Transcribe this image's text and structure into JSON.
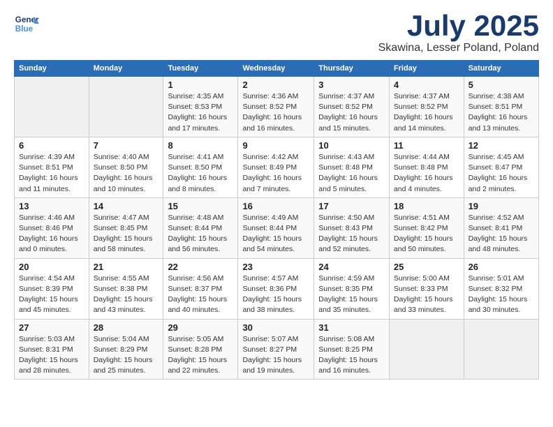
{
  "header": {
    "logo_general": "General",
    "logo_blue": "Blue",
    "month_title": "July 2025",
    "location": "Skawina, Lesser Poland, Poland"
  },
  "weekdays": [
    "Sunday",
    "Monday",
    "Tuesday",
    "Wednesday",
    "Thursday",
    "Friday",
    "Saturday"
  ],
  "weeks": [
    [
      {
        "day": "",
        "detail": ""
      },
      {
        "day": "",
        "detail": ""
      },
      {
        "day": "1",
        "detail": "Sunrise: 4:35 AM\nSunset: 8:53 PM\nDaylight: 16 hours\nand 17 minutes."
      },
      {
        "day": "2",
        "detail": "Sunrise: 4:36 AM\nSunset: 8:52 PM\nDaylight: 16 hours\nand 16 minutes."
      },
      {
        "day": "3",
        "detail": "Sunrise: 4:37 AM\nSunset: 8:52 PM\nDaylight: 16 hours\nand 15 minutes."
      },
      {
        "day": "4",
        "detail": "Sunrise: 4:37 AM\nSunset: 8:52 PM\nDaylight: 16 hours\nand 14 minutes."
      },
      {
        "day": "5",
        "detail": "Sunrise: 4:38 AM\nSunset: 8:51 PM\nDaylight: 16 hours\nand 13 minutes."
      }
    ],
    [
      {
        "day": "6",
        "detail": "Sunrise: 4:39 AM\nSunset: 8:51 PM\nDaylight: 16 hours\nand 11 minutes."
      },
      {
        "day": "7",
        "detail": "Sunrise: 4:40 AM\nSunset: 8:50 PM\nDaylight: 16 hours\nand 10 minutes."
      },
      {
        "day": "8",
        "detail": "Sunrise: 4:41 AM\nSunset: 8:50 PM\nDaylight: 16 hours\nand 8 minutes."
      },
      {
        "day": "9",
        "detail": "Sunrise: 4:42 AM\nSunset: 8:49 PM\nDaylight: 16 hours\nand 7 minutes."
      },
      {
        "day": "10",
        "detail": "Sunrise: 4:43 AM\nSunset: 8:48 PM\nDaylight: 16 hours\nand 5 minutes."
      },
      {
        "day": "11",
        "detail": "Sunrise: 4:44 AM\nSunset: 8:48 PM\nDaylight: 16 hours\nand 4 minutes."
      },
      {
        "day": "12",
        "detail": "Sunrise: 4:45 AM\nSunset: 8:47 PM\nDaylight: 16 hours\nand 2 minutes."
      }
    ],
    [
      {
        "day": "13",
        "detail": "Sunrise: 4:46 AM\nSunset: 8:46 PM\nDaylight: 16 hours\nand 0 minutes."
      },
      {
        "day": "14",
        "detail": "Sunrise: 4:47 AM\nSunset: 8:45 PM\nDaylight: 15 hours\nand 58 minutes."
      },
      {
        "day": "15",
        "detail": "Sunrise: 4:48 AM\nSunset: 8:44 PM\nDaylight: 15 hours\nand 56 minutes."
      },
      {
        "day": "16",
        "detail": "Sunrise: 4:49 AM\nSunset: 8:44 PM\nDaylight: 15 hours\nand 54 minutes."
      },
      {
        "day": "17",
        "detail": "Sunrise: 4:50 AM\nSunset: 8:43 PM\nDaylight: 15 hours\nand 52 minutes."
      },
      {
        "day": "18",
        "detail": "Sunrise: 4:51 AM\nSunset: 8:42 PM\nDaylight: 15 hours\nand 50 minutes."
      },
      {
        "day": "19",
        "detail": "Sunrise: 4:52 AM\nSunset: 8:41 PM\nDaylight: 15 hours\nand 48 minutes."
      }
    ],
    [
      {
        "day": "20",
        "detail": "Sunrise: 4:54 AM\nSunset: 8:39 PM\nDaylight: 15 hours\nand 45 minutes."
      },
      {
        "day": "21",
        "detail": "Sunrise: 4:55 AM\nSunset: 8:38 PM\nDaylight: 15 hours\nand 43 minutes."
      },
      {
        "day": "22",
        "detail": "Sunrise: 4:56 AM\nSunset: 8:37 PM\nDaylight: 15 hours\nand 40 minutes."
      },
      {
        "day": "23",
        "detail": "Sunrise: 4:57 AM\nSunset: 8:36 PM\nDaylight: 15 hours\nand 38 minutes."
      },
      {
        "day": "24",
        "detail": "Sunrise: 4:59 AM\nSunset: 8:35 PM\nDaylight: 15 hours\nand 35 minutes."
      },
      {
        "day": "25",
        "detail": "Sunrise: 5:00 AM\nSunset: 8:33 PM\nDaylight: 15 hours\nand 33 minutes."
      },
      {
        "day": "26",
        "detail": "Sunrise: 5:01 AM\nSunset: 8:32 PM\nDaylight: 15 hours\nand 30 minutes."
      }
    ],
    [
      {
        "day": "27",
        "detail": "Sunrise: 5:03 AM\nSunset: 8:31 PM\nDaylight: 15 hours\nand 28 minutes."
      },
      {
        "day": "28",
        "detail": "Sunrise: 5:04 AM\nSunset: 8:29 PM\nDaylight: 15 hours\nand 25 minutes."
      },
      {
        "day": "29",
        "detail": "Sunrise: 5:05 AM\nSunset: 8:28 PM\nDaylight: 15 hours\nand 22 minutes."
      },
      {
        "day": "30",
        "detail": "Sunrise: 5:07 AM\nSunset: 8:27 PM\nDaylight: 15 hours\nand 19 minutes."
      },
      {
        "day": "31",
        "detail": "Sunrise: 5:08 AM\nSunset: 8:25 PM\nDaylight: 15 hours\nand 16 minutes."
      },
      {
        "day": "",
        "detail": ""
      },
      {
        "day": "",
        "detail": ""
      }
    ]
  ]
}
